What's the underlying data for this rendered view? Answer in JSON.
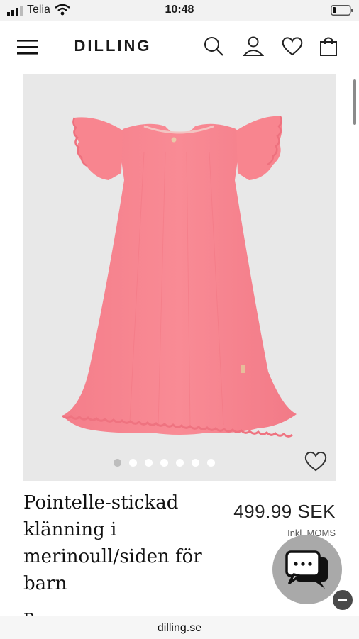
{
  "status_bar": {
    "carrier": "Telia",
    "time": "10:48"
  },
  "header": {
    "brand": "DILLING",
    "icons": [
      "menu-icon",
      "search-icon",
      "account-icon",
      "wishlist-icon",
      "shopping-bag-icon"
    ]
  },
  "gallery": {
    "image_count": 7,
    "active_index": 0
  },
  "product": {
    "name_lines": [
      "Pointelle-stickad",
      "klänning i",
      "merinoull/siden för",
      "barn"
    ],
    "price": "499.99 SEK",
    "tax_note": "Inkl. MOMS",
    "next_text": "Rosa"
  },
  "browser": {
    "url": "dilling.se"
  },
  "colors": {
    "dress": "#f7868f",
    "gallery_bg": "#e8e8e8",
    "chat_button": "#a9a9a9"
  }
}
